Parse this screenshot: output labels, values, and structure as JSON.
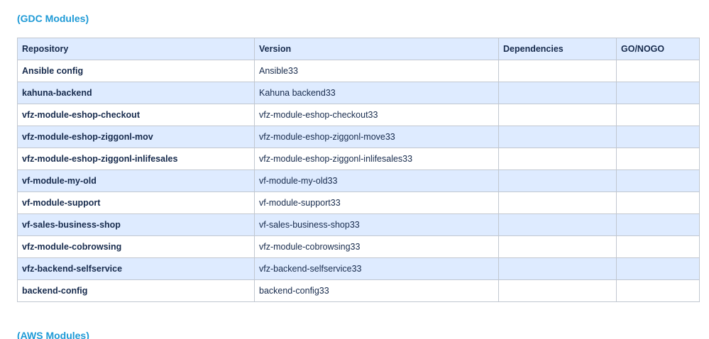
{
  "sections": {
    "gdc_title": "(GDC Modules)",
    "aws_title": "(AWS Modules)"
  },
  "table": {
    "headers": {
      "repository": "Repository",
      "version": "Version",
      "dependencies": "Dependencies",
      "gonogo": "GO/NOGO"
    },
    "rows": [
      {
        "repository": "Ansible config",
        "version": "Ansible33",
        "dependencies": "",
        "gonogo": ""
      },
      {
        "repository": "kahuna-backend",
        "version": "Kahuna backend33",
        "dependencies": "",
        "gonogo": ""
      },
      {
        "repository": "vfz-module-eshop-checkout",
        "version": "vfz-module-eshop-checkout33",
        "dependencies": "",
        "gonogo": ""
      },
      {
        "repository": "vfz-module-eshop-ziggonl-mov",
        "version": "vfz-module-eshop-ziggonl-move33",
        "dependencies": "",
        "gonogo": ""
      },
      {
        "repository": "vfz-module-eshop-ziggonl-inlifesales",
        "version": "vfz-module-eshop-ziggonl-inlifesales33",
        "dependencies": "",
        "gonogo": ""
      },
      {
        "repository": "vf-module-my-old",
        "version": "vf-module-my-old33",
        "dependencies": "",
        "gonogo": ""
      },
      {
        "repository": "vf-module-support",
        "version": "vf-module-support33",
        "dependencies": "",
        "gonogo": ""
      },
      {
        "repository": "vf-sales-business-shop",
        "version": "vf-sales-business-shop33",
        "dependencies": "",
        "gonogo": ""
      },
      {
        "repository": "vfz-module-cobrowsing",
        "version": "vfz-module-cobrowsing33",
        "dependencies": "",
        "gonogo": ""
      },
      {
        "repository": "vfz-backend-selfservice",
        "version": "vfz-backend-selfservice33",
        "dependencies": "",
        "gonogo": ""
      },
      {
        "repository": "backend-config",
        "version": "backend-config33",
        "dependencies": "",
        "gonogo": ""
      }
    ]
  },
  "colors": {
    "heading": "#1e9ad6",
    "header_bg": "#deebff",
    "stripe_bg": "#deebff",
    "border": "#c1c7d0",
    "text": "#172b4d"
  }
}
